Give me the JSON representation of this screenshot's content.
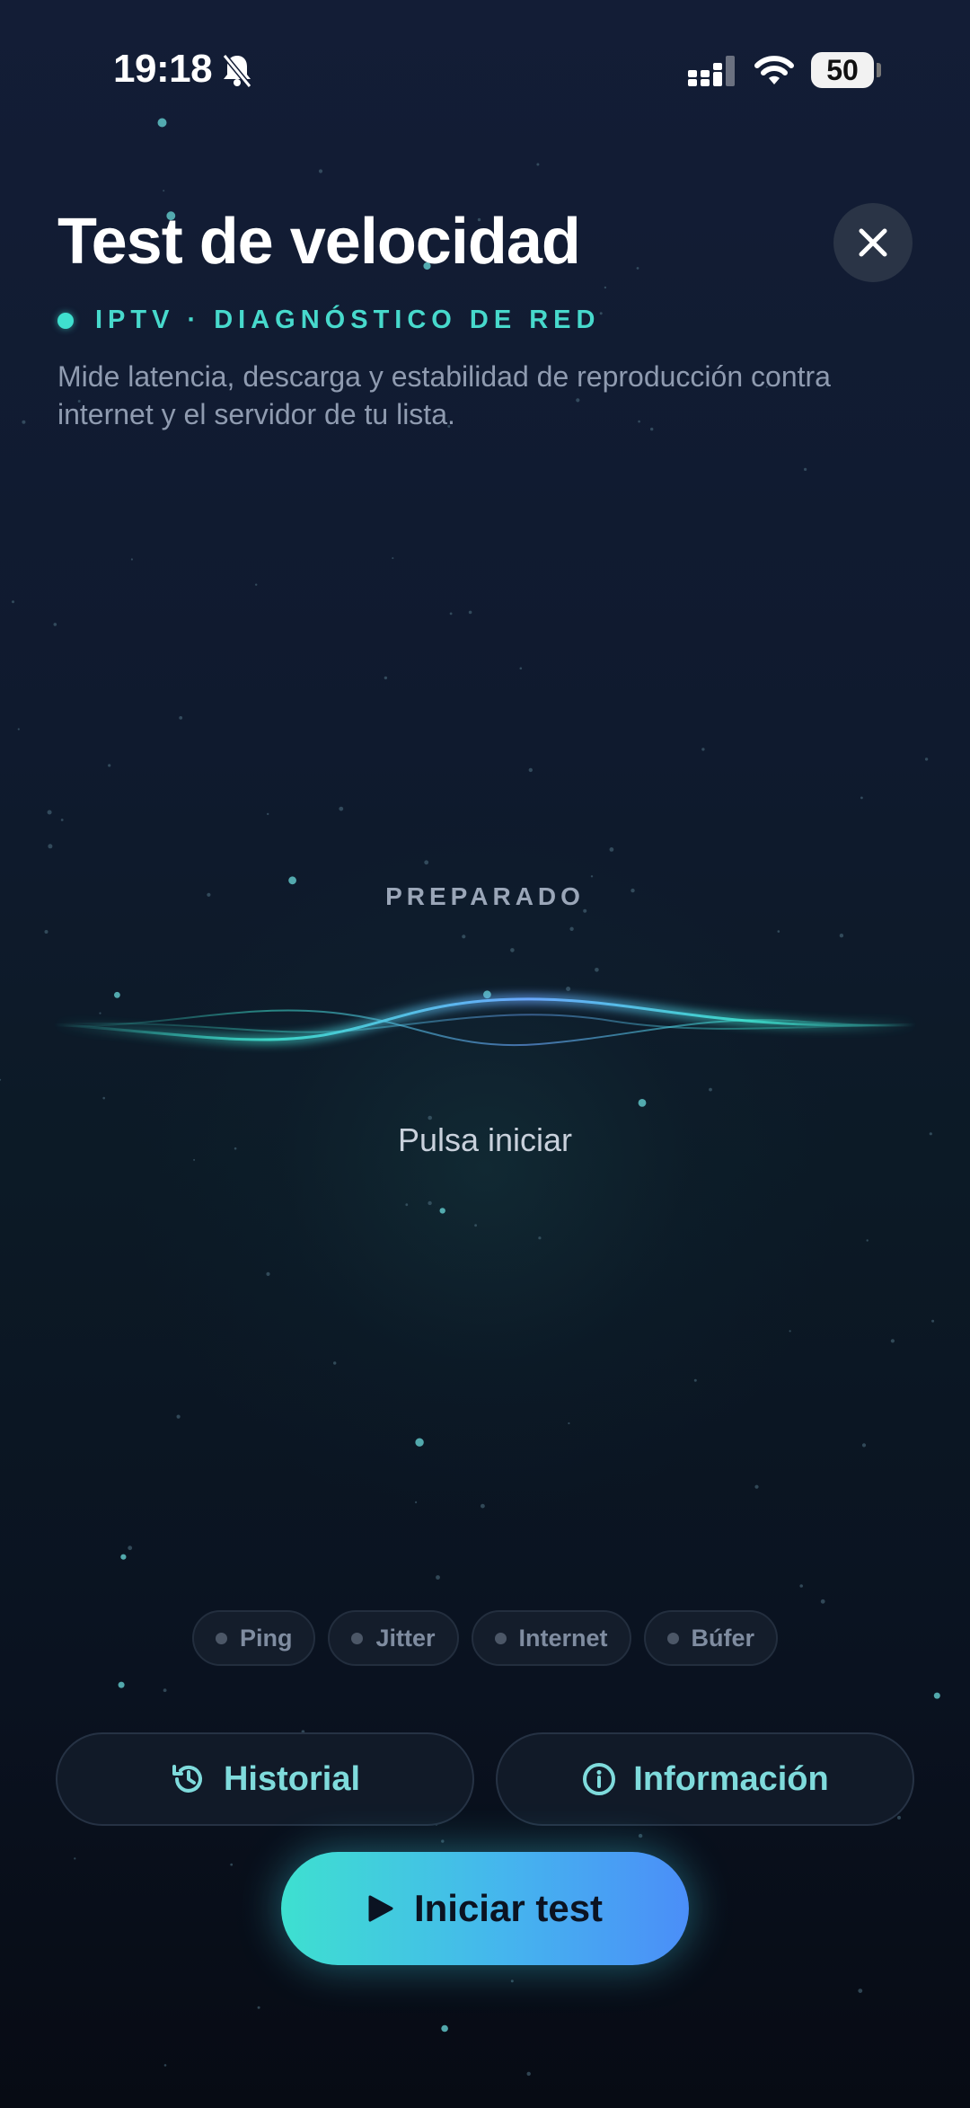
{
  "status_bar": {
    "time": "19:18",
    "battery": "50",
    "icons": [
      "bell-slash-icon",
      "cellular-signal-icon",
      "wifi-icon",
      "battery-icon"
    ]
  },
  "header": {
    "title": "Test de velocidad",
    "tag": "IPTV · DIAGNÓSTICO DE RED",
    "subtitle": "Mide latencia, descarga y estabilidad de reproducción contra internet y el servidor de tu lista.",
    "close_icon": "close-icon"
  },
  "main": {
    "state_label": "PREPARADO",
    "hint": "Pulsa iniciar"
  },
  "metrics": [
    {
      "label": "Ping"
    },
    {
      "label": "Jitter"
    },
    {
      "label": "Internet"
    },
    {
      "label": "Búfer"
    }
  ],
  "actions": {
    "history_label": "Historial",
    "history_icon": "history-icon",
    "info_label": "Información",
    "info_icon": "info-icon",
    "start_label": "Iniciar test",
    "start_icon": "play-icon"
  },
  "colors": {
    "accent_teal": "#3fe0cf",
    "accent_blue": "#4b8ef8",
    "background": "#0f1a2e"
  }
}
